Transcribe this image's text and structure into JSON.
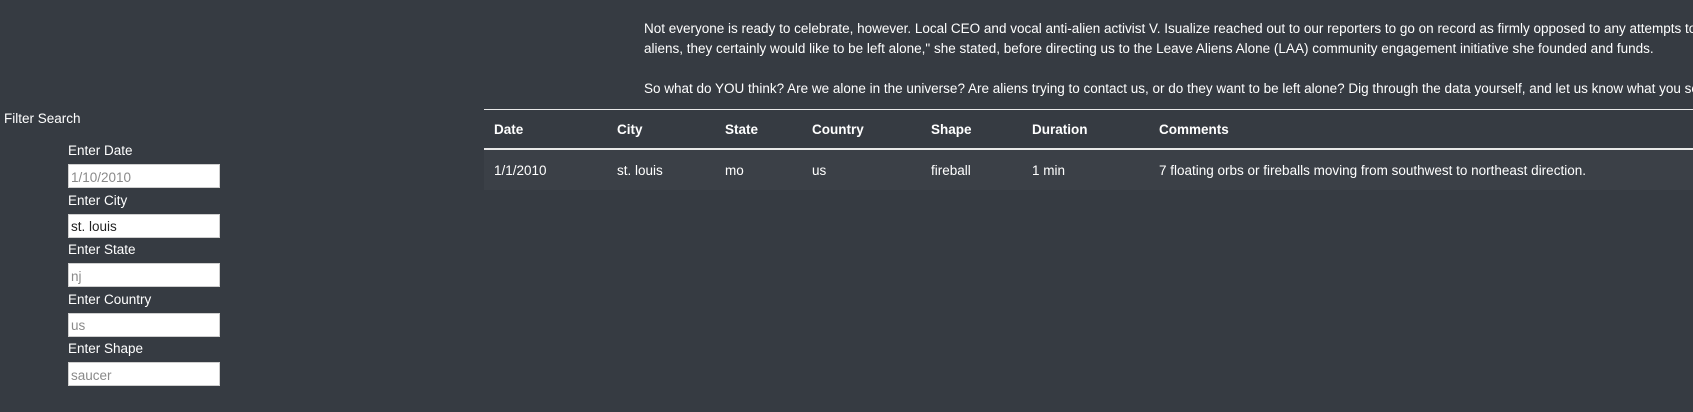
{
  "article": {
    "paragraph_1_line_1": "Not everyone is ready to celebrate, however. Local CEO and vocal anti-alien activist V. Isualize reached out to our reporters to go on record as firmly opposed to any attempts to provide a",
    "paragraph_1_line_2": "aliens, they certainly would like to be left alone,\" she stated, before directing us to the Leave Aliens Alone (LAA) community engagement initiative she founded and funds.",
    "paragraph_2": "So what do YOU think? Are we alone in the universe? Are aliens trying to contact us, or do they want to be left alone? Dig through the data yourself, and let us know what you see."
  },
  "filter": {
    "title": "Filter Search",
    "fields": [
      {
        "label": "Enter Date",
        "value": "",
        "placeholder": "1/10/2010"
      },
      {
        "label": "Enter City",
        "value": "st. louis",
        "placeholder": ""
      },
      {
        "label": "Enter State",
        "value": "",
        "placeholder": "nj"
      },
      {
        "label": "Enter Country",
        "value": "",
        "placeholder": "us"
      },
      {
        "label": "Enter Shape",
        "value": "",
        "placeholder": "saucer"
      }
    ]
  },
  "table": {
    "headers": [
      "Date",
      "City",
      "State",
      "Country",
      "Shape",
      "Duration",
      "Comments"
    ],
    "rows": [
      {
        "date": "1/1/2010",
        "city": "st. louis",
        "state": "mo",
        "country": "us",
        "shape": "fireball",
        "duration": "1 min",
        "comments": "7 floating orbs or fireballs moving from southwest to northeast direction."
      }
    ]
  }
}
